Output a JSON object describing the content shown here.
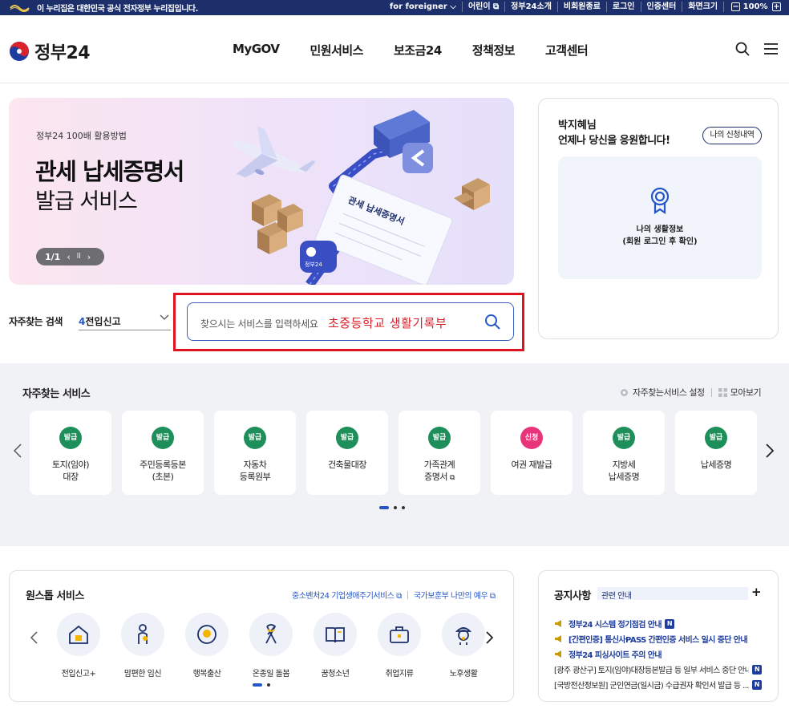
{
  "govbar": {
    "notice": "이 누리집은 대한민국 공식 전자정부 누리집입니다.",
    "links": [
      "for foreigner",
      "어린이",
      "정부24소개",
      "비회원종료",
      "로그인",
      "인증센터",
      "화면크기"
    ],
    "zoom": "100%"
  },
  "header": {
    "brand": "정부24",
    "nav": [
      "MyGOV",
      "민원서비스",
      "보조금24",
      "정책정보",
      "고객센터"
    ]
  },
  "hero": {
    "eyebrow": "정부24 100배 활용방법",
    "title_line1": "관세 납세증명서",
    "title_line2": "발급 서비스",
    "pager": "1/1",
    "doc_label": "관세 납세증명서",
    "badge_label": "정부24"
  },
  "search": {
    "fav_label": "자주찾는 검색",
    "fav_num": "4",
    "fav_value": "전입신고",
    "placeholder": "찾으시는 서비스를 입력하세요",
    "typed": "초중등학교 생활기록부"
  },
  "profile": {
    "greet1": "박지혜님",
    "greet2": "언제나 당신을 응원합니다!",
    "my_button": "나의 신청내역",
    "info_line1": "나의 생활정보",
    "info_line2": "(회원 로그인 후 확인)"
  },
  "services": {
    "heading": "자주찾는 서비스",
    "settings": "자주찾는서비스 설정",
    "gather": "모아보기",
    "items": [
      {
        "badge": "발급",
        "line1": "토지(임야)",
        "line2": "대장"
      },
      {
        "badge": "발급",
        "line1": "주민등록등본",
        "line2": "(초본)"
      },
      {
        "badge": "발급",
        "line1": "자동차",
        "line2": "등록원부"
      },
      {
        "badge": "발급",
        "line1": "건축물대장",
        "line2": ""
      },
      {
        "badge": "발급",
        "line1": "가족관계",
        "line2": "증명서"
      },
      {
        "badge": "신청",
        "line1": "여권 재발급",
        "line2": ""
      },
      {
        "badge": "발급",
        "line1": "지방세",
        "line2": "납세증명"
      },
      {
        "badge": "발급",
        "line1": "납세증명",
        "line2": ""
      }
    ]
  },
  "onestop": {
    "heading": "원스톱 서비스",
    "link1": "중소벤처24 기업생애주기서비스",
    "link2": "국가보훈부 나만의 예우",
    "items": [
      "전입신고+",
      "맘편한 임신",
      "행복출산",
      "온종일 돌봄",
      "꿈청소년",
      "취업지류",
      "노후생활"
    ]
  },
  "notice": {
    "heading": "공지사항",
    "tab": "관련 안내",
    "items": [
      {
        "text": "정부24 시스템 정기점검 안내",
        "urgent": true
      },
      {
        "text": "[간편인증] 통신사PASS 간편인증 서비스 일시 중단 안내",
        "urgent": true
      },
      {
        "text": "정부24 피싱사이트 주의 안내",
        "urgent": true
      },
      {
        "text": "[광주 광산구] 토지(임야)대장등본발급 등 일부 서비스 중단 안내",
        "urgent": false
      },
      {
        "text": "[국방전산정보원] 군인연금(일시금) 수급권자 확인서 발급 등 ...",
        "urgent": false
      }
    ],
    "new_badge": "N"
  },
  "colors": {
    "navy": "#1d2f6a",
    "accent_blue": "#2456c6",
    "badge_green": "#1e8e5a",
    "badge_pink": "#e8347a",
    "highlight_red": "#e0141e"
  }
}
